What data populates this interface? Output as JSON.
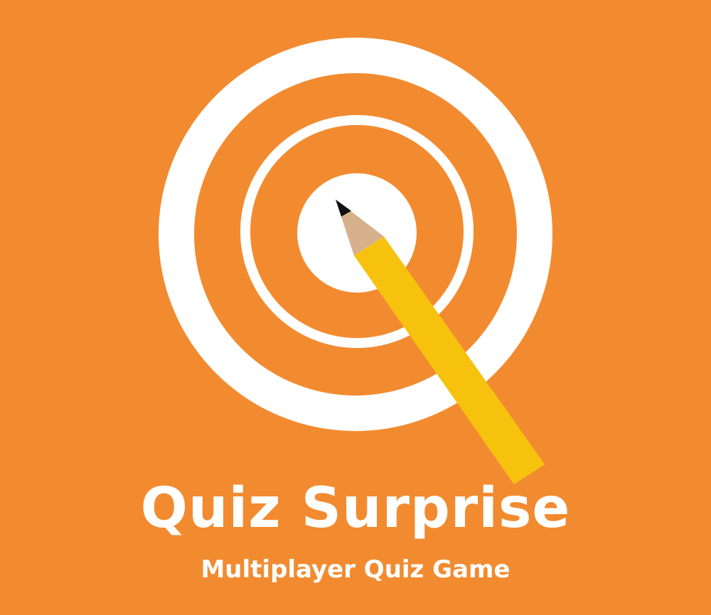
{
  "title": "Quiz Surprise",
  "subtitle": "Multiplayer Quiz Game",
  "logo": {
    "icon": "target-q-with-pencil-icon",
    "colors": {
      "background": "#f28b30",
      "rings": "#ffffff",
      "pencil_body": "#f7c20e",
      "pencil_wood": "#d7b08c",
      "pencil_lead": "#111111"
    }
  }
}
